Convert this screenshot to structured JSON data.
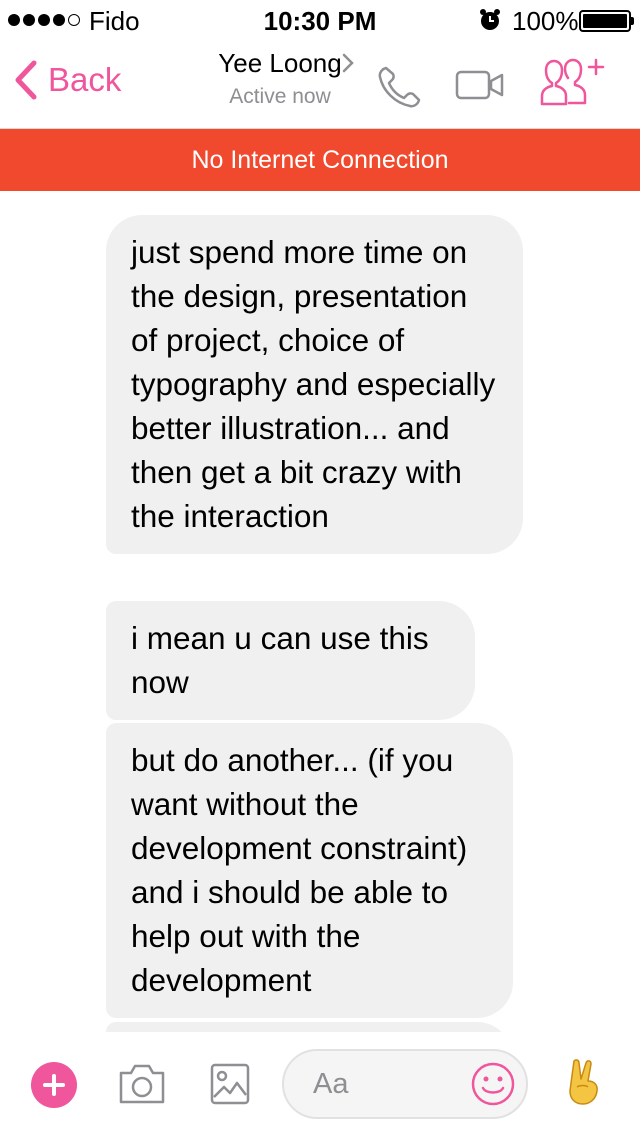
{
  "status": {
    "carrier": "Fido",
    "time": "10:30 PM",
    "battery": "100%",
    "signal_bars_filled": 4,
    "signal_bars_total": 5
  },
  "nav": {
    "back_label": "Back",
    "contact_name": "Yee Loong",
    "contact_status": "Active now",
    "icons": [
      "call-icon",
      "video-call-icon",
      "add-people-icon"
    ]
  },
  "banner": {
    "text": "No Internet Connection"
  },
  "messages": [
    {
      "text": "just spend more time on the design, presentation of project, choice of typography and especially better illustration... and then get a bit crazy with the interaction"
    },
    {
      "text": "i mean u can use this now"
    },
    {
      "text": "but do another... (if you want without the development constraint) and i should be able to help out with the development"
    }
  ],
  "composer": {
    "placeholder": "Aa",
    "icons": [
      "add-icon",
      "camera-icon",
      "image-icon",
      "emoji-icon",
      "victory-hand-icon"
    ]
  },
  "colors": {
    "accent": "#f0569c",
    "banner": "#f0492d",
    "bubble": "#f1f0f0",
    "secondary_text": "#8e8e93"
  }
}
